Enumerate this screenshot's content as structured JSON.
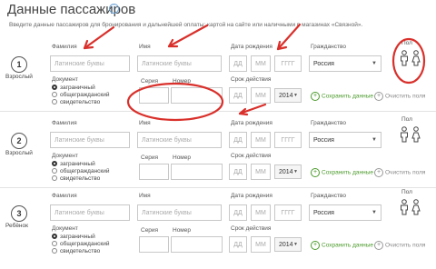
{
  "page": {
    "title": "Данные пассажиров",
    "subtitle": "Введите данные пассажиров для бронирования и дальнейшей оплаты: картой на сайте или наличными в магазинах «Связной»."
  },
  "labels": {
    "surname": "Фамилия",
    "name": "Имя",
    "birth": "Дата рождения",
    "citizenship": "Гражданство",
    "gender": "Пол",
    "document": "Документ",
    "series": "Серия",
    "number": "Номер",
    "validity": "Срок действия",
    "save": "Сохранить данные",
    "clear": "Очистить поля"
  },
  "placeholders": {
    "latin": "Латинские буквы",
    "day": "ДД",
    "month": "ММ",
    "year": "ГГГГ"
  },
  "doc_types": [
    "заграничный",
    "общегражданский",
    "свидетельство"
  ],
  "passengers": [
    {
      "number": "1",
      "type": "Взрослый",
      "citizenship": "Россия",
      "validity_year": "2014",
      "selected_doc": 0
    },
    {
      "number": "2",
      "type": "Взрослый",
      "citizenship": "Россия",
      "validity_year": "2014",
      "selected_doc": 0
    },
    {
      "number": "3",
      "type": "Ребёнок",
      "citizenship": "Россия",
      "validity_year": "2014",
      "selected_doc": 0
    }
  ],
  "colors": {
    "annotation": "#d9302b",
    "link": "#4a9a2a"
  }
}
